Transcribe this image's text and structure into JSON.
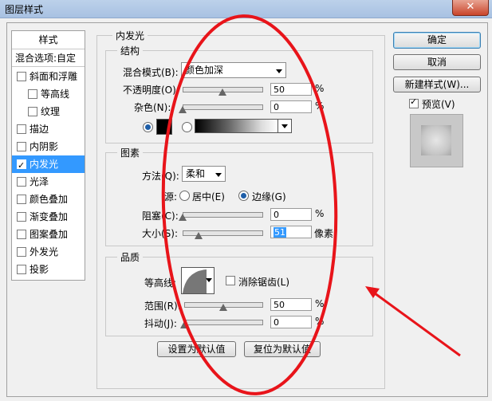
{
  "window": {
    "title": "图层样式",
    "close": "✕"
  },
  "left": {
    "header": "样式",
    "blend": "混合选项:自定",
    "items": [
      {
        "label": "斜面和浮雕",
        "checked": false
      },
      {
        "label": "等高线",
        "checked": false
      },
      {
        "label": "纹理",
        "checked": false
      },
      {
        "label": "描边",
        "checked": false
      },
      {
        "label": "内阴影",
        "checked": false
      },
      {
        "label": "内发光",
        "checked": true
      },
      {
        "label": "光泽",
        "checked": false
      },
      {
        "label": "颜色叠加",
        "checked": false
      },
      {
        "label": "渐变叠加",
        "checked": false
      },
      {
        "label": "图案叠加",
        "checked": false
      },
      {
        "label": "外发光",
        "checked": false
      },
      {
        "label": "投影",
        "checked": false
      }
    ]
  },
  "panel": {
    "title": "内发光",
    "structure": {
      "title": "结构",
      "blend_label": "混合模式(B):",
      "blend_value": "颜色加深",
      "opacity_label": "不透明度(O):",
      "opacity_value": "50",
      "opacity_unit": "%",
      "opacity_level": 0.5,
      "noise_label": "杂色(N):",
      "noise_value": "0",
      "noise_unit": "%",
      "noise_level": 0.0
    },
    "elements": {
      "title": "图素",
      "method_label": "方法(Q):",
      "method_value": "柔和",
      "source_label": "源:",
      "source_center": "居中(E)",
      "source_edge": "边缘(G)",
      "choke_label": "阻塞(C):",
      "choke_value": "0",
      "choke_unit": "%",
      "choke_level": 0.0,
      "size_label": "大小(S):",
      "size_value": "51",
      "size_unit": "像素",
      "size_level": 0.2
    },
    "quality": {
      "title": "品质",
      "contour_label": "等高线:",
      "antialias_label": "消除锯齿(L)",
      "range_label": "范围(R):",
      "range_value": "50",
      "range_unit": "%",
      "range_level": 0.5,
      "jitter_label": "抖动(J):",
      "jitter_value": "0",
      "jitter_unit": "%",
      "jitter_level": 0.0
    },
    "make_default": "设置为默认值",
    "reset_default": "复位为默认值"
  },
  "right": {
    "ok": "确定",
    "cancel": "取消",
    "new_style": "新建样式(W)...",
    "preview_label": "预览(V)",
    "preview_checked": true
  },
  "annotation_color": "#e8141a"
}
